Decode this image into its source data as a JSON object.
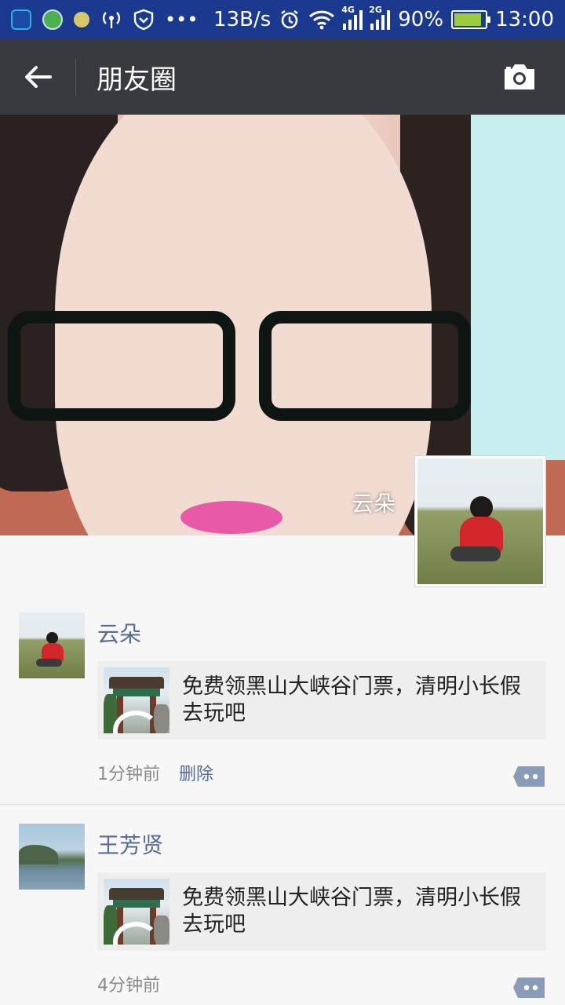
{
  "status_bar": {
    "net_speed": "13B/s",
    "signal_1_tag": "4G",
    "signal_2_tag": "2G",
    "battery": "90%",
    "battery_level": 0.9,
    "time": "13:00"
  },
  "app_bar": {
    "title": "朋友圈"
  },
  "cover": {
    "user_name": "云朵"
  },
  "posts": [
    {
      "author": "云朵",
      "share_text": "免费领黑山大峡谷门票，清明小长假去玩吧",
      "time": "1分钟前",
      "delete_label": "删除"
    },
    {
      "author": "王芳贤",
      "share_text": "免费领黑山大峡谷门票，清明小长假去玩吧",
      "time": "4分钟前"
    }
  ],
  "colors": {
    "status_bar": "#1b3a8f",
    "app_bar": "#393a3f",
    "link_blue": "#576b95",
    "feed_bg": "#f7f7f7"
  }
}
